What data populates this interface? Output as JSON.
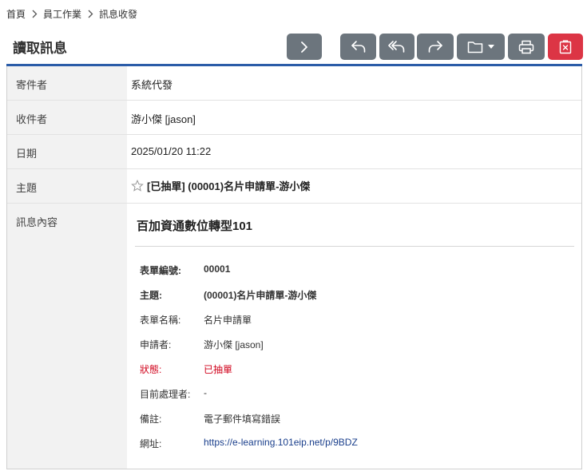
{
  "breadcrumb": {
    "items": [
      "首頁",
      "員工作業",
      "訊息收發"
    ]
  },
  "page_title": "讀取訊息",
  "toolbar": {
    "buttons": [
      {
        "name": "next",
        "icon": "chevron-right-icon"
      },
      {
        "name": "reply",
        "icon": "reply-icon"
      },
      {
        "name": "reply-all",
        "icon": "reply-all-icon"
      },
      {
        "name": "forward",
        "icon": "forward-icon"
      },
      {
        "name": "move-folder",
        "icon": "folder-dropdown-icon"
      },
      {
        "name": "print",
        "icon": "printer-icon"
      },
      {
        "name": "delete",
        "icon": "delete-icon"
      }
    ],
    "colors": {
      "default": "#6c757d",
      "danger": "#dc3545"
    }
  },
  "message": {
    "sender_label": "寄件者",
    "sender": "系統代發",
    "recipient_label": "收件者",
    "recipient": "游小傑 [jason]",
    "date_label": "日期",
    "date": "2025/01/20 11:22",
    "subject_label": "主題",
    "subject": "[已抽單] (00001)名片申請單-游小傑",
    "content_label": "訊息內容"
  },
  "content": {
    "company": "百加資通數位轉型101",
    "fields": [
      {
        "key": "表單編號:",
        "value": "00001",
        "style": "bold"
      },
      {
        "key": "主題:",
        "value": "(00001)名片申請單-游小傑",
        "style": "bold"
      },
      {
        "key": "表單名稱:",
        "value": "名片申請單",
        "style": "normal"
      },
      {
        "key": "申請者:",
        "value": "游小傑 [jason]",
        "style": "normal"
      },
      {
        "key": "狀態:",
        "value": "已抽單",
        "style": "red"
      },
      {
        "key": "目前處理者:",
        "value": "-",
        "style": "normal"
      },
      {
        "key": "備註:",
        "value": "電子郵件填寫錯誤",
        "style": "normal"
      },
      {
        "key": "網址:",
        "value": "https://e-learning.101eip.net/p/9BDZ",
        "style": "link"
      }
    ]
  }
}
